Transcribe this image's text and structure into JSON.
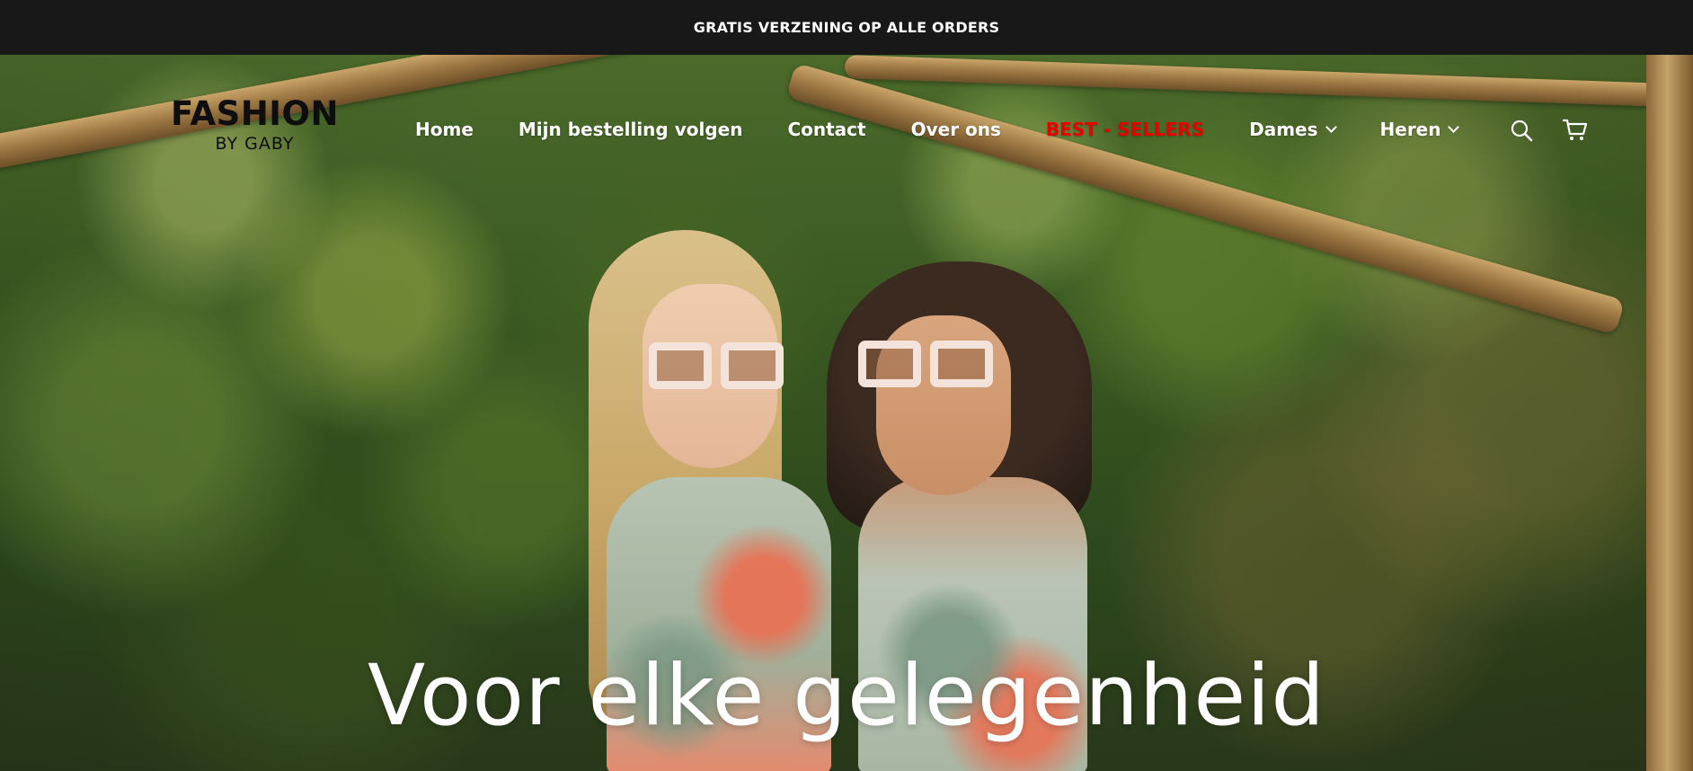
{
  "announcement": {
    "text": "GRATIS VERZENING OP ALLE ORDERS"
  },
  "logo": {
    "main": "FASHION",
    "sub": "BY GABY"
  },
  "nav": {
    "items": [
      {
        "label": "Home"
      },
      {
        "label": "Mijn bestelling volgen"
      },
      {
        "label": "Contact"
      },
      {
        "label": "Over ons"
      },
      {
        "label": "BEST - SELLERS",
        "color": "#e60000"
      },
      {
        "label": "Dames",
        "has_dropdown": true
      },
      {
        "label": "Heren",
        "has_dropdown": true
      }
    ]
  },
  "icons": {
    "search": "search-icon",
    "cart": "cart-icon"
  },
  "hero": {
    "headline": "Voor elke gelegenheid"
  },
  "colors": {
    "announcement_bg": "#181818",
    "nav_text": "#ffffff",
    "highlight": "#e60000",
    "logo_text": "#0e0e0e"
  }
}
